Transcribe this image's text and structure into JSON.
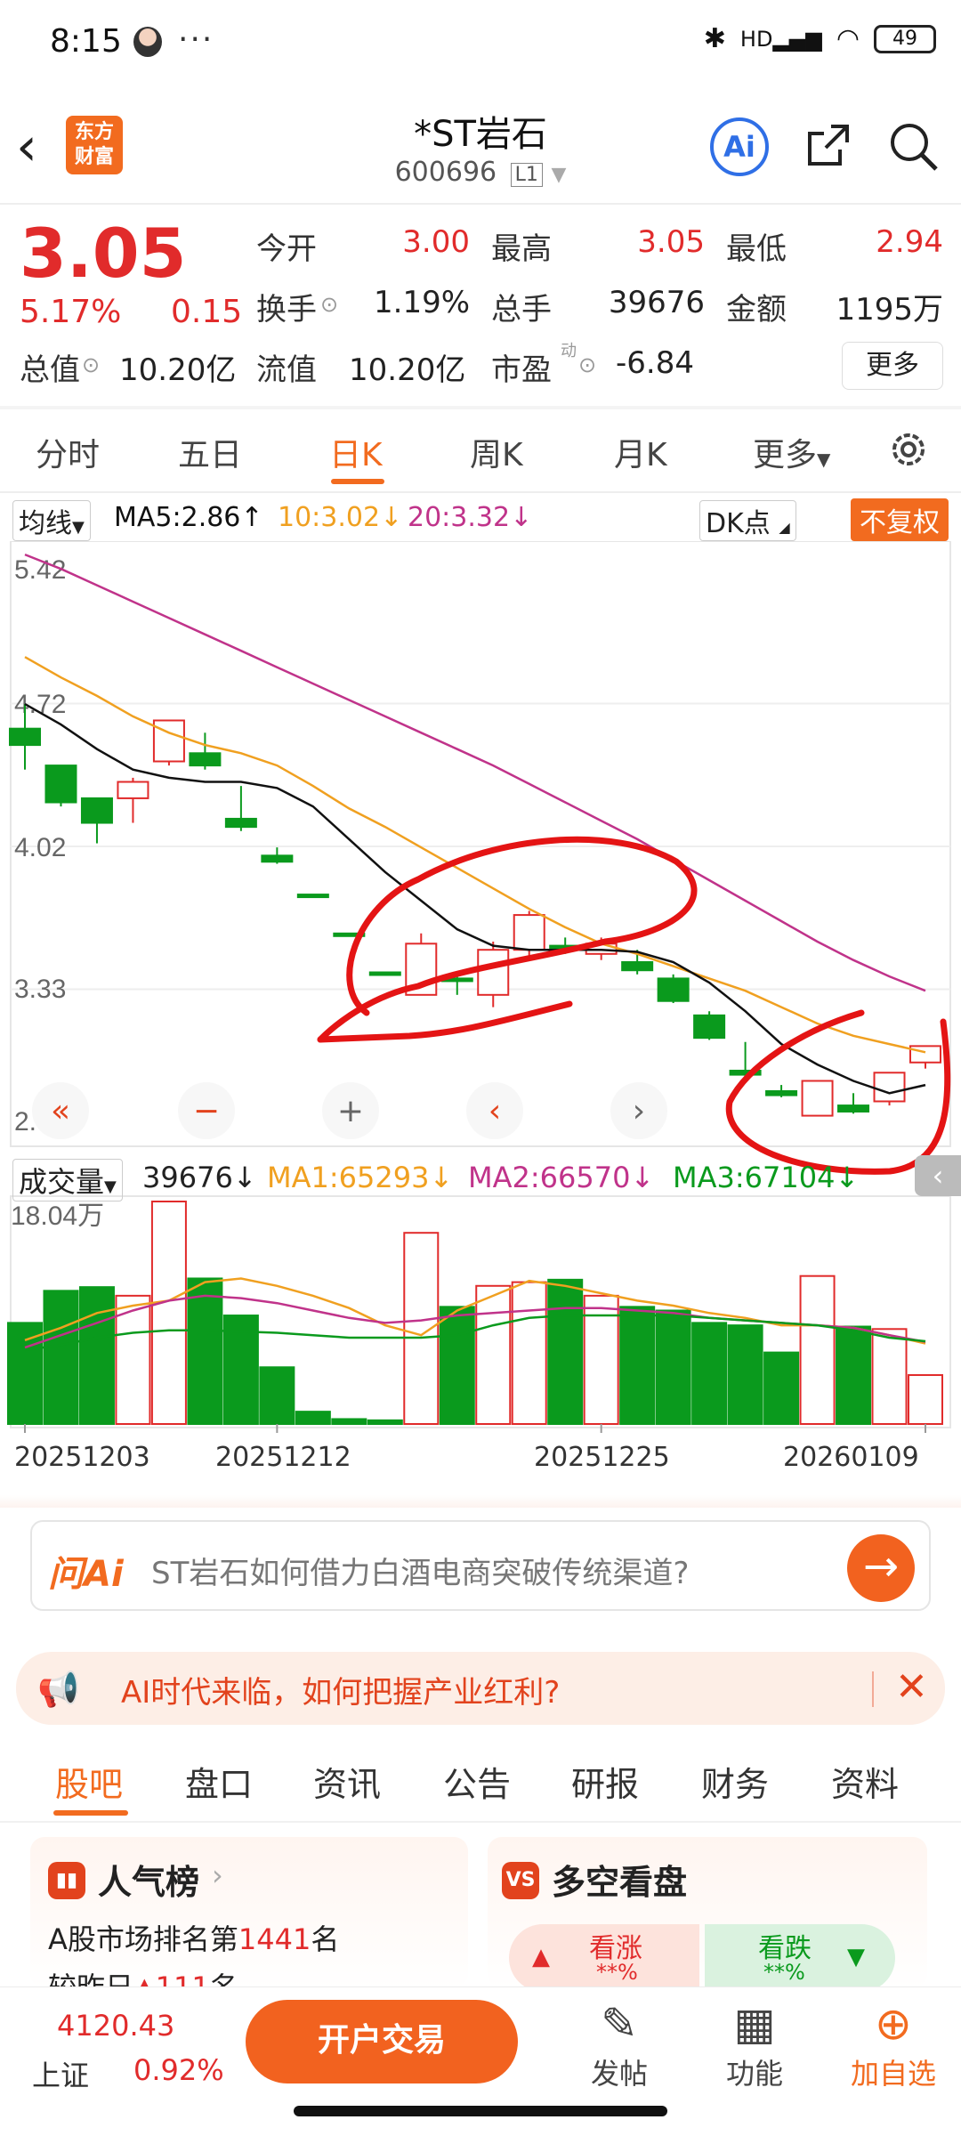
{
  "status_bar": {
    "time": "8:15",
    "more": "···",
    "battery": "49",
    "hd": "HD"
  },
  "header": {
    "logo_text": "东方\n财富",
    "stock_name": "*ST岩石",
    "stock_code": "600696",
    "level": "L1",
    "ai_label": "Ai"
  },
  "quote": {
    "price": "3.05",
    "change_pct": "5.17%",
    "change": "0.15",
    "rows": [
      [
        {
          "label": "今开",
          "value": "3.00",
          "red": true
        },
        {
          "label": "最高",
          "value": "3.05",
          "red": true
        },
        {
          "label": "最低",
          "value": "2.94",
          "red": true
        }
      ],
      [
        {
          "label": "换手",
          "value": "1.19%",
          "red": false
        },
        {
          "label": "总手",
          "value": "39676",
          "red": false
        },
        {
          "label": "金额",
          "value": "1195万",
          "red": false
        }
      ]
    ],
    "total_value_label": "总值",
    "total_value": "10.20亿",
    "float_value_label": "流值",
    "float_value": "10.20亿",
    "pe_label": "市盈",
    "pe_sup": "动",
    "pe_value": "-6.84",
    "more_label": "更多"
  },
  "chart_tabs": [
    "分时",
    "五日",
    "日K",
    "周K",
    "月K",
    "更多"
  ],
  "active_chart_tab": "日K",
  "ma_line": {
    "selector": "均线",
    "ma5": "MA5:2.86",
    "ma10": "10:3.02",
    "ma20": "20:3.32",
    "dk": "DK点",
    "adjust": "不复权",
    "colors": {
      "ma5": "#111111",
      "ma10": "#f0a020",
      "ma20": "#c0338a",
      "up": "#e12b2b",
      "down": "#0a9a1d"
    }
  },
  "volume_legend": {
    "selector": "成交量",
    "vol": "39676",
    "ma1": "MA1:65293",
    "ma2": "MA2:66570",
    "ma3": "MA3:67104"
  },
  "chart_data": [
    {
      "type": "candlestick",
      "y_ticks": [
        "5.42",
        "4.72",
        "4.02",
        "3.33",
        "2.63"
      ],
      "ylim": [
        2.63,
        5.42
      ],
      "x_ticks": [
        "20251203",
        "20251212",
        "20251225",
        "20260109"
      ],
      "candles": [
        {
          "o": 4.6,
          "c": 4.52,
          "h": 4.72,
          "l": 4.4
        },
        {
          "o": 4.42,
          "c": 4.24,
          "h": 4.42,
          "l": 4.22
        },
        {
          "o": 4.26,
          "c": 4.14,
          "h": 4.26,
          "l": 4.04
        },
        {
          "o": 4.26,
          "c": 4.34,
          "h": 4.36,
          "l": 4.14
        },
        {
          "o": 4.44,
          "c": 4.64,
          "h": 4.64,
          "l": 4.42
        },
        {
          "o": 4.48,
          "c": 4.42,
          "h": 4.58,
          "l": 4.4
        },
        {
          "o": 4.16,
          "c": 4.12,
          "h": 4.32,
          "l": 4.1
        },
        {
          "o": 3.98,
          "c": 3.95,
          "h": 4.02,
          "l": 3.94
        },
        {
          "o": 3.79,
          "c": 3.78,
          "h": 3.79,
          "l": 3.78
        },
        {
          "o": 3.6,
          "c": 3.59,
          "h": 3.6,
          "l": 3.59
        },
        {
          "o": 3.41,
          "c": 3.4,
          "h": 3.41,
          "l": 3.4
        },
        {
          "o": 3.3,
          "c": 3.55,
          "h": 3.6,
          "l": 3.3
        },
        {
          "o": 3.38,
          "c": 3.37,
          "h": 3.4,
          "l": 3.3
        },
        {
          "o": 3.3,
          "c": 3.52,
          "h": 3.56,
          "l": 3.24
        },
        {
          "o": 3.52,
          "c": 3.69,
          "h": 3.71,
          "l": 3.48
        },
        {
          "o": 3.54,
          "c": 3.52,
          "h": 3.58,
          "l": 3.5
        },
        {
          "o": 3.5,
          "c": 3.55,
          "h": 3.58,
          "l": 3.47
        },
        {
          "o": 3.46,
          "c": 3.42,
          "h": 3.52,
          "l": 3.4
        },
        {
          "o": 3.38,
          "c": 3.27,
          "h": 3.4,
          "l": 3.26
        },
        {
          "o": 3.2,
          "c": 3.09,
          "h": 3.22,
          "l": 3.08
        },
        {
          "o": 2.93,
          "c": 2.91,
          "h": 3.07,
          "l": 2.9
        },
        {
          "o": 2.83,
          "c": 2.81,
          "h": 2.86,
          "l": 2.8
        },
        {
          "o": 2.71,
          "c": 2.88,
          "h": 2.88,
          "l": 2.71
        },
        {
          "o": 2.76,
          "c": 2.73,
          "h": 2.82,
          "l": 2.72
        },
        {
          "o": 2.78,
          "c": 2.92,
          "h": 2.92,
          "l": 2.76
        },
        {
          "o": 2.97,
          "c": 3.05,
          "h": 3.05,
          "l": 2.94
        }
      ],
      "ma5": [
        4.72,
        4.62,
        4.5,
        4.4,
        4.36,
        4.34,
        4.34,
        4.31,
        4.22,
        4.06,
        3.9,
        3.76,
        3.62,
        3.54,
        3.52,
        3.52,
        3.52,
        3.51,
        3.46,
        3.36,
        3.22,
        3.06,
        2.96,
        2.88,
        2.82,
        2.86
      ],
      "ma10": [
        4.95,
        4.85,
        4.76,
        4.66,
        4.58,
        4.52,
        4.48,
        4.42,
        4.32,
        4.21,
        4.12,
        4.02,
        3.92,
        3.82,
        3.72,
        3.63,
        3.55,
        3.5,
        3.44,
        3.38,
        3.32,
        3.24,
        3.16,
        3.1,
        3.06,
        3.02
      ],
      "ma20": [
        5.45,
        5.38,
        5.3,
        5.22,
        5.14,
        5.06,
        4.98,
        4.9,
        4.82,
        4.74,
        4.66,
        4.58,
        4.5,
        4.42,
        4.33,
        4.24,
        4.15,
        4.06,
        3.96,
        3.86,
        3.76,
        3.66,
        3.56,
        3.47,
        3.39,
        3.32
      ]
    },
    {
      "type": "bar",
      "title": "成交量",
      "y_max_label": "18.04万",
      "ylim": [
        0,
        180400
      ],
      "values": [
        82000,
        108000,
        111000,
        104000,
        180400,
        118000,
        88000,
        46000,
        10000,
        4000,
        3000,
        155000,
        95000,
        112000,
        115000,
        117000,
        104000,
        95000,
        92000,
        82000,
        80000,
        58000,
        120000,
        79000,
        77000,
        39676
      ],
      "up": [
        false,
        false,
        false,
        true,
        true,
        false,
        false,
        false,
        false,
        false,
        false,
        true,
        false,
        true,
        true,
        false,
        true,
        false,
        false,
        false,
        false,
        false,
        true,
        false,
        true,
        true
      ],
      "ma1": [
        68000,
        78000,
        90000,
        96000,
        100000,
        115000,
        118000,
        112000,
        104000,
        94000,
        80000,
        72000,
        92000,
        104000,
        116000,
        112000,
        106000,
        100000,
        96000,
        90000,
        86000,
        80000,
        80000,
        78000,
        72000,
        65293
      ],
      "ma2": [
        62000,
        72000,
        82000,
        92000,
        100000,
        104000,
        102000,
        98000,
        92000,
        86000,
        82000,
        84000,
        88000,
        90000,
        92000,
        94000,
        94000,
        92000,
        90000,
        86000,
        84000,
        82000,
        80000,
        78000,
        72000,
        66570
      ],
      "ma3": [
        60000,
        64000,
        70000,
        74000,
        76000,
        76000,
        75000,
        74000,
        72000,
        70000,
        70000,
        70000,
        72000,
        80000,
        86000,
        88000,
        88000,
        88000,
        88000,
        86000,
        84000,
        82000,
        80000,
        76000,
        70000,
        67104
      ]
    }
  ],
  "ask_ai": {
    "logo": "问Ai",
    "prompt": "ST岩石如何借力白酒电商突破传统渠道?"
  },
  "banner": {
    "text": "AI时代来临，如何把握产业红利?"
  },
  "bottom_tabs": [
    "股吧",
    "盘口",
    "资讯",
    "公告",
    "研报",
    "财务",
    "资料"
  ],
  "active_bottom_tab": "股吧",
  "cards": {
    "popularity": {
      "title": "人气榜",
      "line1_prefix": "A股市场排名第",
      "rank": "1441",
      "line1_suffix": "名",
      "line2": "较昨日",
      "line2_value": "111",
      "line2_suffix": "名"
    },
    "bull_bear": {
      "title": "多空看盘",
      "bull": "看涨",
      "bull_pct": "**%",
      "bear": "看跌",
      "bear_pct": "**%"
    }
  },
  "bottom_bar": {
    "index_value": "4120.43",
    "index_name": "上证",
    "index_pct": "0.92%",
    "trade_label": "开户交易",
    "nav": [
      {
        "label": "发帖",
        "icon": "edit-icon"
      },
      {
        "label": "功能",
        "icon": "grid-icon"
      },
      {
        "label": "加自选",
        "icon": "plus-circle-icon"
      }
    ]
  }
}
